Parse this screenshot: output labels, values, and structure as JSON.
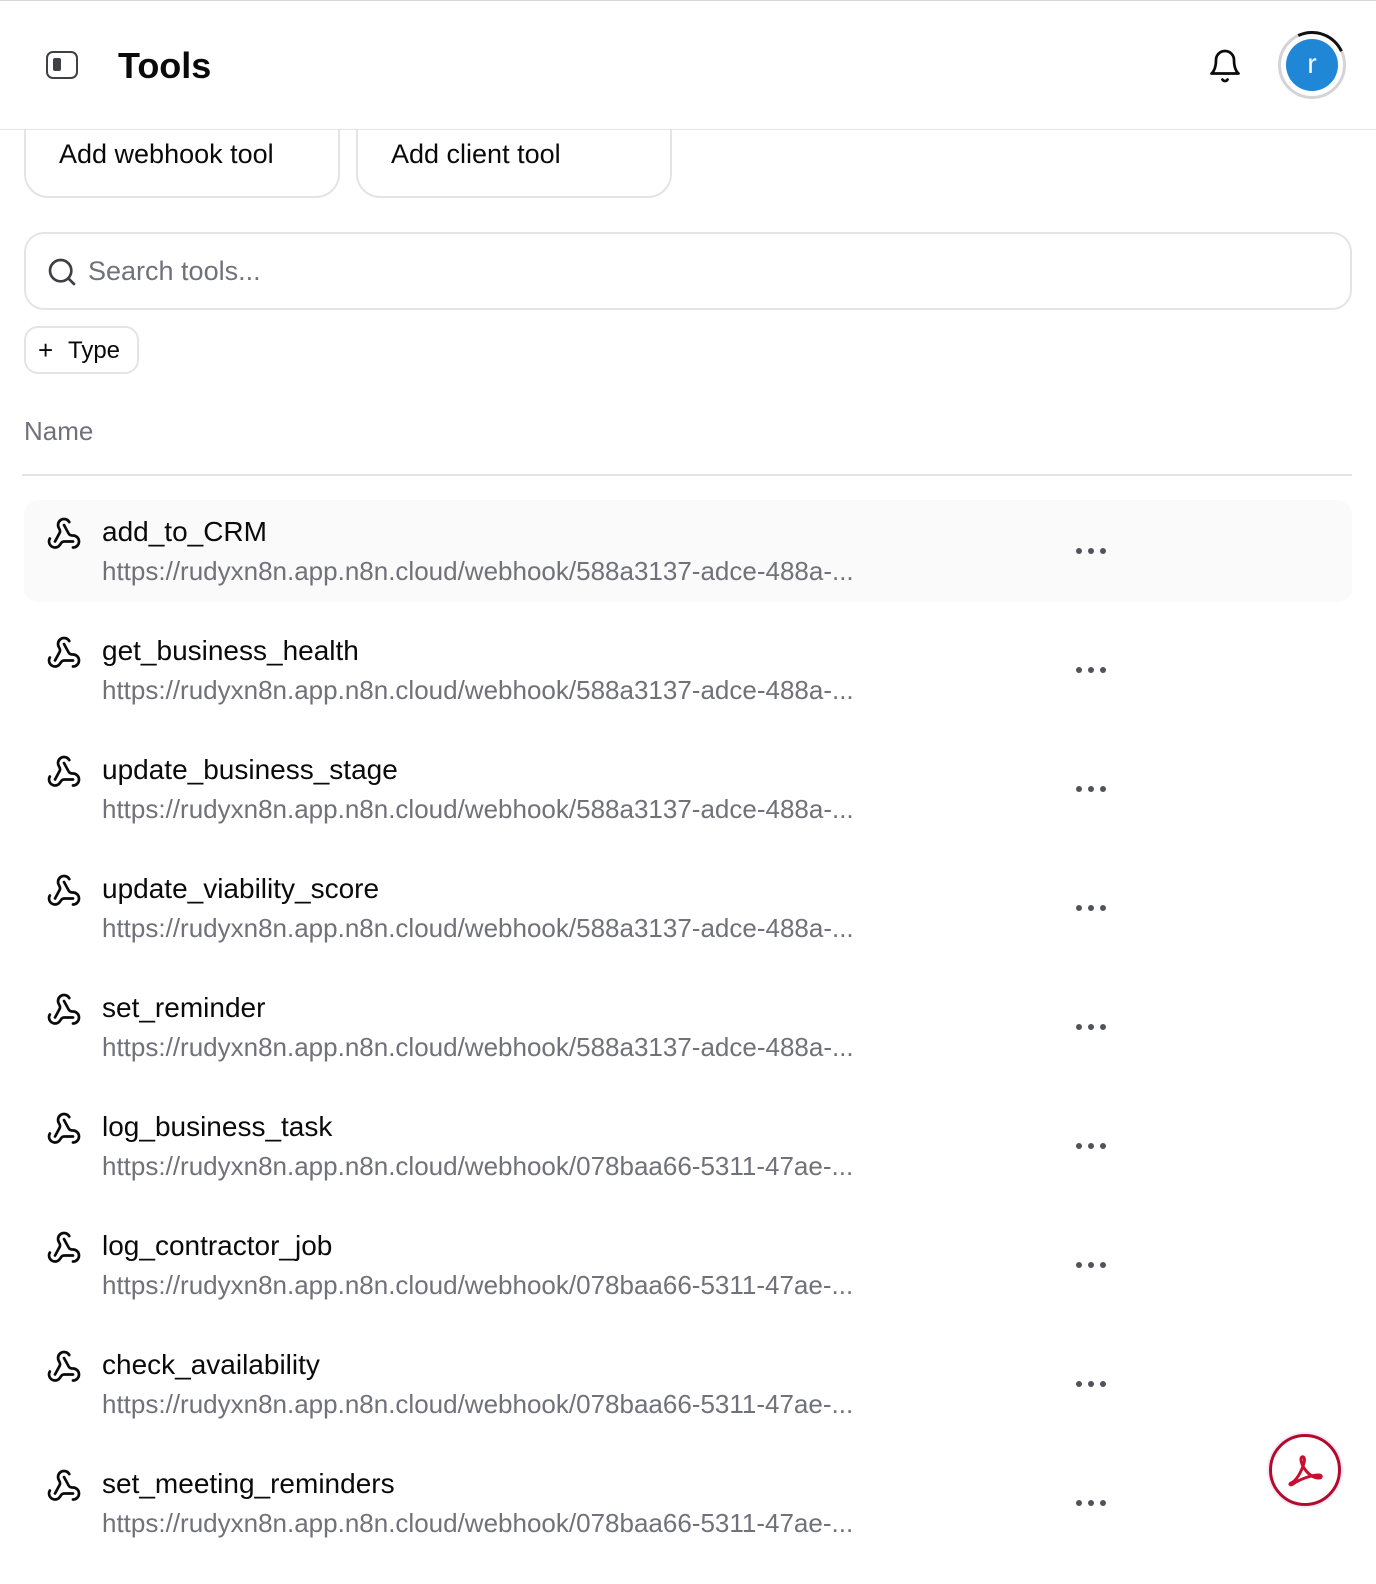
{
  "header": {
    "title": "Tools",
    "avatar_initial": "r"
  },
  "actions": {
    "add_webhook_label": "Add webhook tool",
    "add_client_label": "Add client tool"
  },
  "search": {
    "placeholder": "Search tools...",
    "value": ""
  },
  "filters": {
    "type_label": "Type",
    "plus": "+"
  },
  "table": {
    "column_name": "Name",
    "rows": [
      {
        "name": "add_to_CRM",
        "url": "https://rudyxn8n.app.n8n.cloud/webhook/588a3137-adce-488a-..."
      },
      {
        "name": "get_business_health",
        "url": "https://rudyxn8n.app.n8n.cloud/webhook/588a3137-adce-488a-..."
      },
      {
        "name": "update_business_stage",
        "url": "https://rudyxn8n.app.n8n.cloud/webhook/588a3137-adce-488a-..."
      },
      {
        "name": "update_viability_score",
        "url": "https://rudyxn8n.app.n8n.cloud/webhook/588a3137-adce-488a-..."
      },
      {
        "name": "set_reminder",
        "url": "https://rudyxn8n.app.n8n.cloud/webhook/588a3137-adce-488a-..."
      },
      {
        "name": "log_business_task",
        "url": "https://rudyxn8n.app.n8n.cloud/webhook/078baa66-5311-47ae-..."
      },
      {
        "name": "log_contractor_job",
        "url": "https://rudyxn8n.app.n8n.cloud/webhook/078baa66-5311-47ae-..."
      },
      {
        "name": "check_availability",
        "url": "https://rudyxn8n.app.n8n.cloud/webhook/078baa66-5311-47ae-..."
      },
      {
        "name": "set_meeting_reminders",
        "url": "https://rudyxn8n.app.n8n.cloud/webhook/078baa66-5311-47ae-..."
      }
    ]
  },
  "icons": {
    "sidebar_toggle": "sidebar-toggle-icon",
    "notifications": "bell-icon",
    "search": "search-icon",
    "row_type": "webhook-icon",
    "row_menu": "more-horizontal-icon",
    "floating": "pdf-icon"
  },
  "colors": {
    "avatar": "#1f87d6",
    "pdf_accent": "#b10d2a",
    "muted_text": "#71717a",
    "border": "#e4e4e7"
  }
}
